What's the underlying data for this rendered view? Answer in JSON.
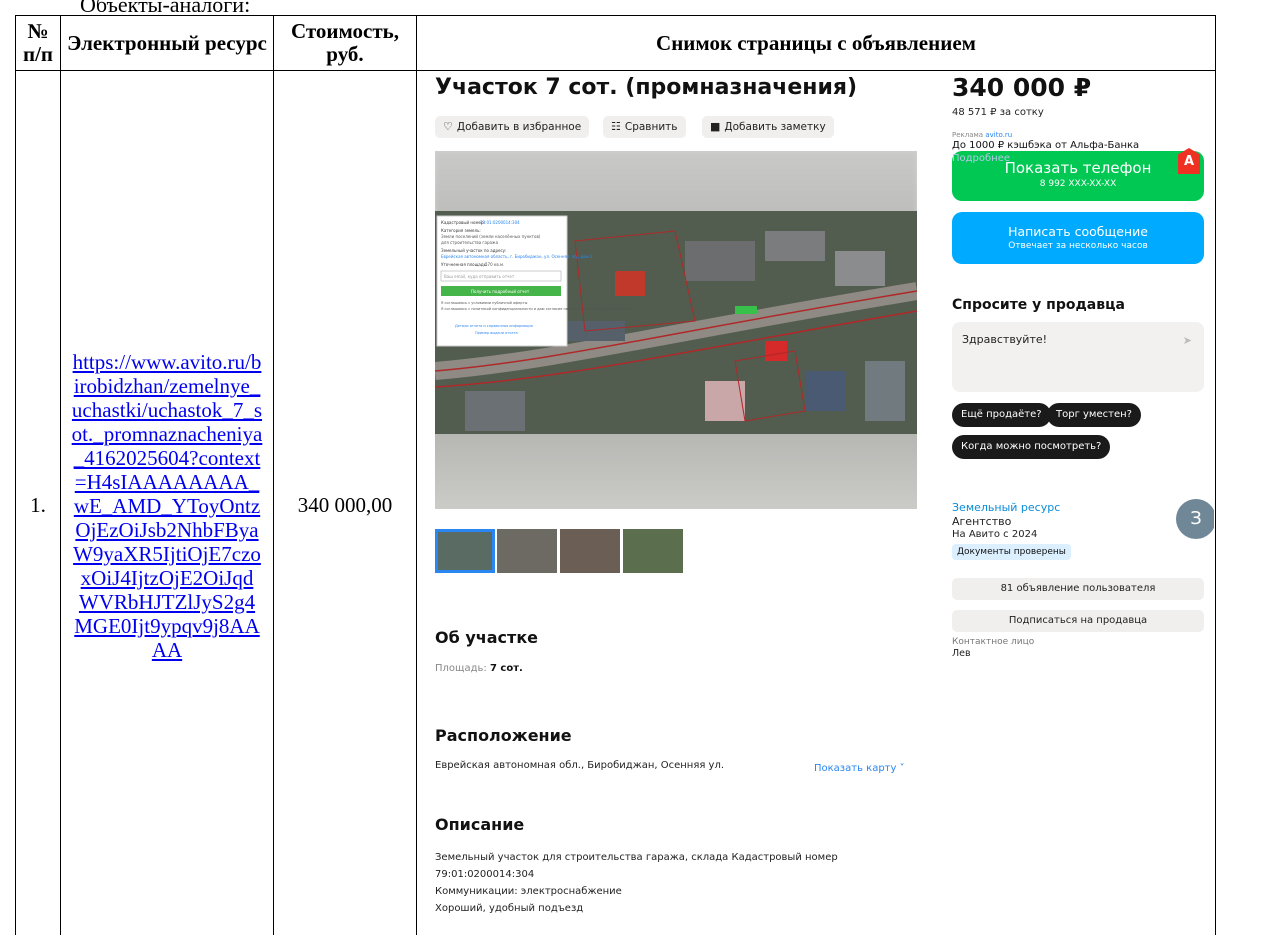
{
  "caption_fragment": "Объекты-аналоги:",
  "table": {
    "headers": [
      "№ п/п",
      "Электронный ресурс",
      "Стоимость, руб.",
      "Снимок страницы с объявлением"
    ],
    "rows": [
      {
        "num": "1.",
        "url": "https://www.avito.ru/birobidzhan/zemelnye_uchastki/uchastok_7_sot._promnaznacheniya_4162025604?context=H4sIAAAAAAAA_wE_AMD_YToyOntzOjEzOiJsb2NhbFByaW9yaXR5IjtiOjE7czoxOiJ4IjtzOjE2OiJqdWVRbHJTZlJyS2g4MGE0Ijt9ypqv9j8AAAA",
        "price": "340 000,00"
      }
    ]
  },
  "snapshot": {
    "title": "Участок 7 сот. (промназначения)",
    "price": "340 000 ₽",
    "price_per_sotka": "48 571 ₽ за сотку",
    "actions": {
      "favorite": "Добавить в избранное",
      "compare": "Сравнить",
      "note": "Добавить заметку"
    },
    "ad": {
      "label": "Реклама",
      "label_link": "avito.ru",
      "text": "До 1000 ₽ кэшбэка от Альфа-Банка",
      "more": "Подробнее",
      "badge": "А"
    },
    "show_phone": {
      "label": "Показать телефон",
      "sub": "8 992 XXX-XX-XX"
    },
    "write_message": {
      "label": "Написать сообщение",
      "sub": "Отвечает за несколько часов"
    },
    "ask_seller": {
      "heading": "Спросите у продавца",
      "message": "Здравствуйте!",
      "chips": [
        "Ещё продаёте?",
        "Торг уместен?",
        "Когда можно посмотреть?"
      ]
    },
    "seller": {
      "name": "Земельный ресурс",
      "type": "Агентство",
      "since": "На Авито с 2024",
      "docs": "Документы проверены",
      "avatar_letter": "З",
      "listings_btn": "81 объявление пользователя",
      "subscribe_btn": "Подписаться на продавца",
      "contact_label": "Контактное лицо",
      "contact_name": "Лев"
    },
    "about": {
      "heading": "Об участке",
      "area_label": "Площадь:",
      "area_value": "7 сот."
    },
    "location": {
      "heading": "Расположение",
      "address": "Еврейская автономная обл., Биробиджан, Осенняя ул.",
      "show_map": "Показать карту"
    },
    "description": {
      "heading": "Описание",
      "lines": [
        "Земельный участок для строительства гаража, склада Кадастровый номер",
        "79:01:0200014:304",
        "Коммуникации: электроснабжение",
        "Хороший, удобный подъезд"
      ]
    },
    "popup": {
      "cadastral_label": "Кадастровый номер:",
      "cadastral_value": "79:01:0200014:304",
      "category_label": "Категория земель:",
      "category_value": "Земли поселений (земли населённых пунктов)",
      "use": "для строительства гаража",
      "address_label": "Земельный участок по адресу:",
      "address_value": "Еврейская автономная область, г. Биробиджан, ул. Осенняя, з/у, дом 1",
      "area_label": "Уточненная площадь:",
      "area_value": "570 кв.м.",
      "email_placeholder": "Ваш email, куда отправить отчет",
      "get_report": "Получить подробный отчет",
      "consent1": "Я соглашаюсь с условиями публичной оферты",
      "consent2": "Я соглашаюсь с политикой конфиденциальности и даю согласие на обработку персональных данных",
      "detail_link": "Детали отчета и справочная информация",
      "example_link": "Пример выдачи отчета"
    },
    "icon_names": {
      "favorite": "heart-icon",
      "compare": "compare-icon",
      "note": "note-icon",
      "send": "send-icon",
      "show_map": "chevron-down-icon"
    },
    "colors": {
      "green": "#00c853",
      "blue": "#00aaff",
      "link": "#2a86f0",
      "alfa": "#ef3124"
    }
  }
}
